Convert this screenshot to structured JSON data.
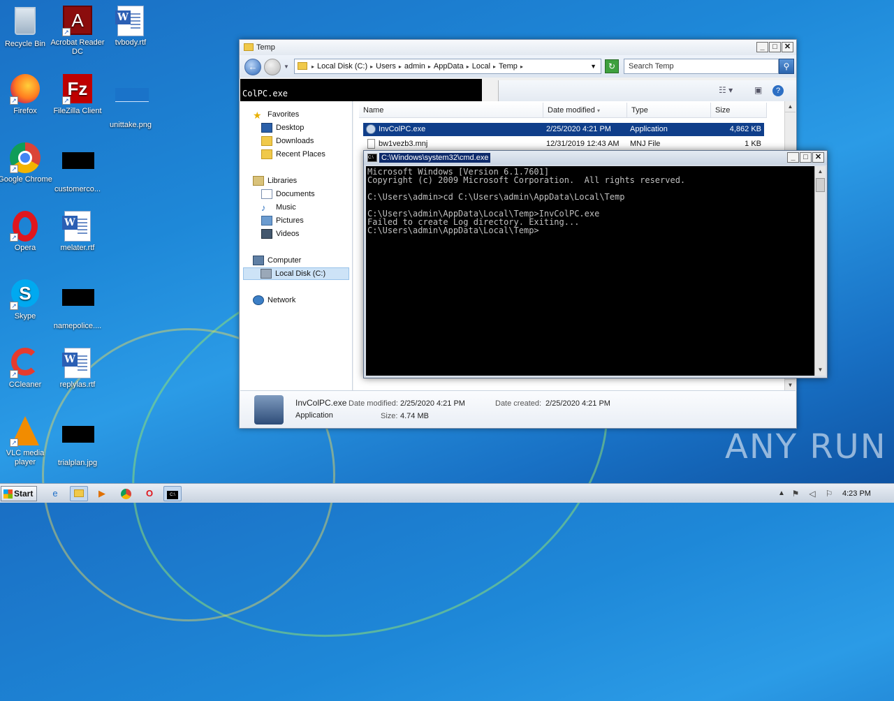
{
  "desktop": {
    "icons": [
      {
        "label": "Recycle Bin"
      },
      {
        "label": "Acrobat Reader DC"
      },
      {
        "label": "tvbody.rtf"
      },
      {
        "label": "Firefox"
      },
      {
        "label": "FileZilla Client"
      },
      {
        "label": "unittake.png"
      },
      {
        "label": "Google Chrome"
      },
      {
        "label": "customerco..."
      },
      {
        "label": "Opera"
      },
      {
        "label": "melater.rtf"
      },
      {
        "label": "Skype"
      },
      {
        "label": "namepolice...."
      },
      {
        "label": "CCleaner"
      },
      {
        "label": "replylas.rtf"
      },
      {
        "label": "VLC media player"
      },
      {
        "label": "trialplan.jpg"
      }
    ],
    "watermark": "ANY RUN"
  },
  "explorer": {
    "title": "Temp",
    "breadcrumb": [
      "Local Disk (C:)",
      "Users",
      "admin",
      "AppData",
      "Local",
      "Temp"
    ],
    "search_placeholder": "Search Temp",
    "cmd_peek": "ColPC.exe",
    "nav": {
      "favorites": "Favorites",
      "desktop": "Desktop",
      "downloads": "Downloads",
      "recent": "Recent Places",
      "libraries": "Libraries",
      "documents": "Documents",
      "music": "Music",
      "pictures": "Pictures",
      "videos": "Videos",
      "computer": "Computer",
      "localdisk": "Local Disk (C:)",
      "network": "Network"
    },
    "columns": {
      "name": "Name",
      "date": "Date modified",
      "type": "Type",
      "size": "Size"
    },
    "files": [
      {
        "name": "InvColPC.exe",
        "date": "2/25/2020 4:21 PM",
        "type": "Application",
        "size": "4,862 KB"
      },
      {
        "name": "bw1vezb3.mnj",
        "date": "12/31/2019 12:43 AM",
        "type": "MNJ File",
        "size": "1 KB"
      }
    ],
    "details": {
      "name": "InvColPC.exe",
      "type": "Application",
      "modified_label": "Date modified:",
      "modified": "2/25/2020 4:21 PM",
      "created_label": "Date created:",
      "created": "2/25/2020 4:21 PM",
      "size_label": "Size:",
      "size": "4.74 MB"
    }
  },
  "cmd": {
    "title": "C:\\Windows\\system32\\cmd.exe",
    "lines": [
      "Microsoft Windows [Version 6.1.7601]",
      "Copyright (c) 2009 Microsoft Corporation.  All rights reserved.",
      "",
      "C:\\Users\\admin>cd C:\\Users\\admin\\AppData\\Local\\Temp",
      "",
      "C:\\Users\\admin\\AppData\\Local\\Temp>InvColPC.exe",
      "Failed to create Log directory. Exiting...",
      "C:\\Users\\admin\\AppData\\Local\\Temp>"
    ]
  },
  "taskbar": {
    "start": "Start",
    "clock": "4:23 PM"
  }
}
